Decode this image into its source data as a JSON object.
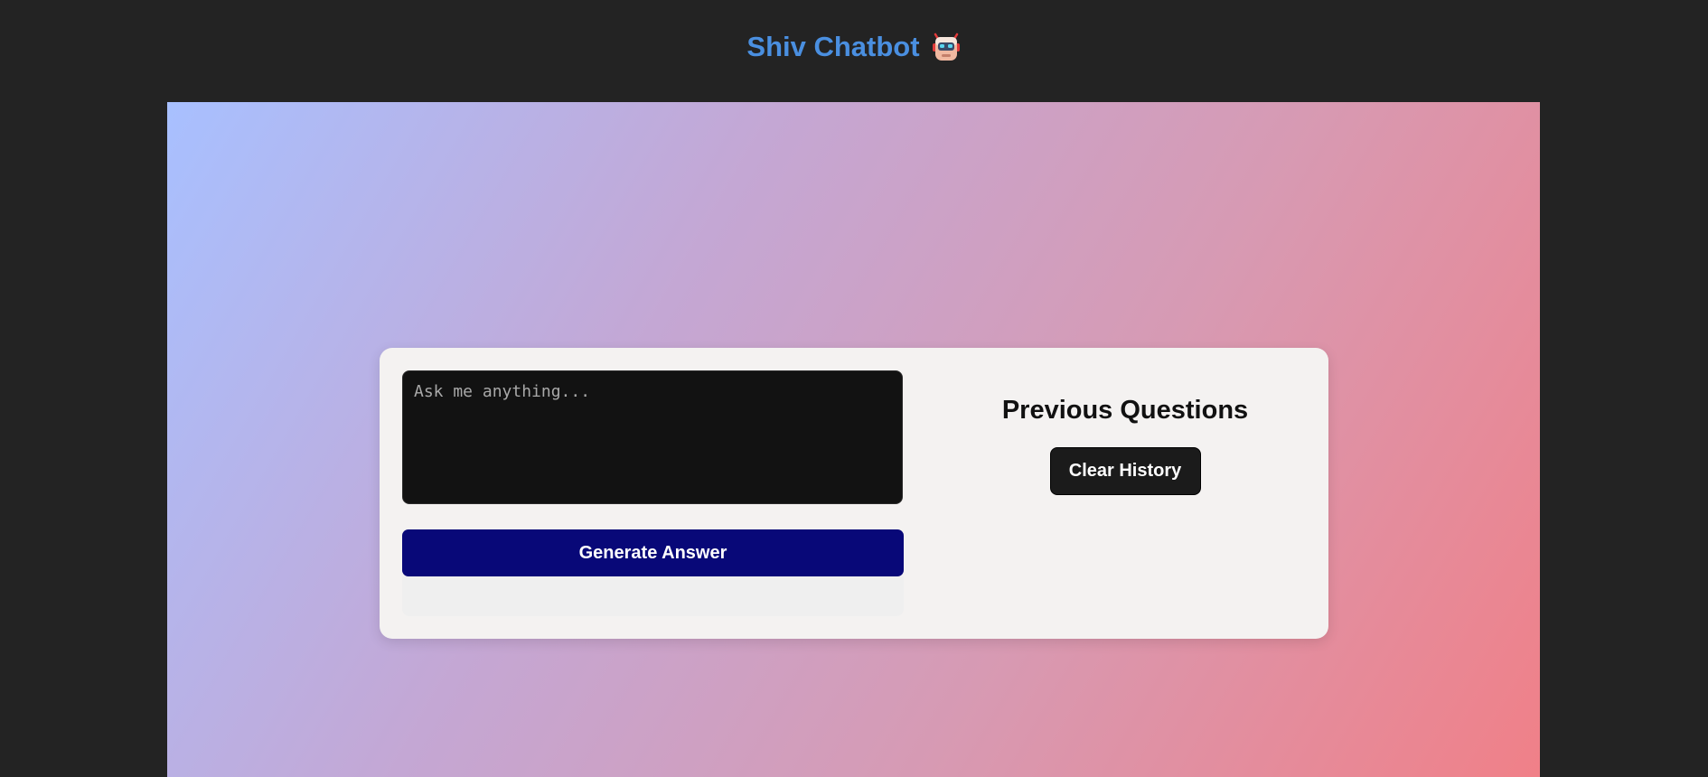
{
  "header": {
    "title": "Shiv Chatbot",
    "icon": "robot-icon"
  },
  "colors": {
    "title": "#4a8fe0",
    "page_background": "#232323",
    "gradient_start": "#a8c0ff",
    "gradient_end": "#f08088",
    "card_background": "#f4f2f1",
    "input_background": "#121212",
    "primary_button": "#080878",
    "secondary_button": "#1b1b1b"
  },
  "chat": {
    "input_placeholder": "Ask me anything...",
    "input_value": "",
    "generate_label": "Generate Answer",
    "answer_text": ""
  },
  "history": {
    "heading": "Previous Questions",
    "clear_label": "Clear History",
    "items": []
  }
}
